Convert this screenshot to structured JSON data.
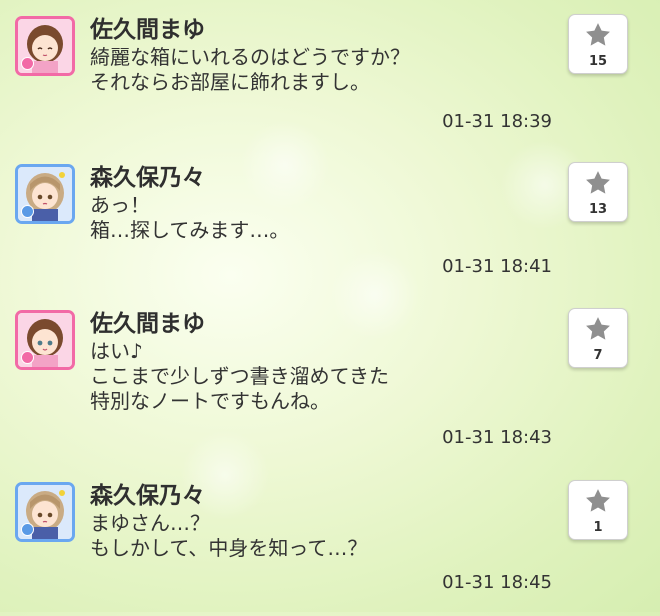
{
  "messages": [
    {
      "name": "佐久間まゆ",
      "text": "綺麗な箱にいれるのはどうですか？\nそれならお部屋に飾れますし。",
      "time": "01-31 18:39",
      "likes": "15",
      "avatar_theme": "pink",
      "avatar_icon": "mayu-avatar-icon"
    },
    {
      "name": "森久保乃々",
      "text": "あっ！\n箱…探してみます…。",
      "time": "01-31 18:41",
      "likes": "13",
      "avatar_theme": "blue",
      "avatar_icon": "nono-avatar-icon"
    },
    {
      "name": "佐久間まゆ",
      "text": "はい♪\nここまで少しずつ書き溜めてきた\n特別なノートですもんね。",
      "time": "01-31 18:43",
      "likes": "7",
      "avatar_theme": "pink",
      "avatar_icon": "mayu-avatar-icon"
    },
    {
      "name": "森久保乃々",
      "text": "まゆさん…？\nもしかして、中身を知って…？",
      "time": "01-31 18:45",
      "likes": "1",
      "avatar_theme": "blue",
      "avatar_icon": "nono-avatar-icon"
    }
  ],
  "colors": {
    "pink_frame": "#f26aa6",
    "blue_frame": "#6aa7f0",
    "star": "#8f8f8f",
    "background": "#e4f4c6"
  }
}
